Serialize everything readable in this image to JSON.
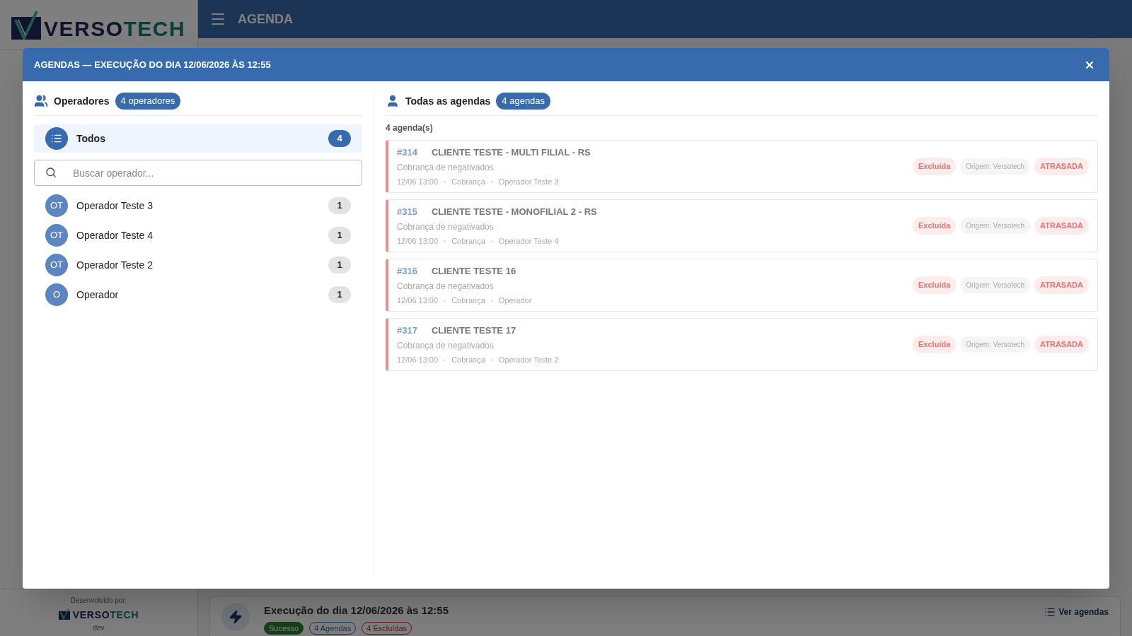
{
  "brand": {
    "part1": "VERSO",
    "part2": "TECH"
  },
  "topbar": {
    "title": "AGENDA"
  },
  "footer": {
    "caption": "Desenvolvido por:",
    "brand": {
      "part1": "VERSO",
      "part2": "TECH"
    },
    "env": "dev"
  },
  "execution": {
    "title": "Execução do dia 12/06/2026 às 12:55",
    "link": "Ver agendas",
    "badges": [
      {
        "label": "Sucesso",
        "kind": "success"
      },
      {
        "label": "4 Agendas",
        "kind": "info"
      },
      {
        "label": "4 Excluídas",
        "kind": "danger"
      }
    ]
  },
  "modal": {
    "title": "AGENDAS — EXECUÇÃO DO DIA 12/06/2026 ÀS 12:55",
    "operators": {
      "title": "Operadores",
      "count": "4 operadores",
      "all": {
        "label": "Todos",
        "count": "4",
        "selected": true
      },
      "search": {
        "placeholder": "Buscar operador..."
      },
      "items": [
        {
          "initials": "OT",
          "name": "Operador Teste 3",
          "count": "1",
          "selected": false
        },
        {
          "initials": "OT",
          "name": "Operador Teste 4",
          "count": "1",
          "selected": false
        },
        {
          "initials": "OT",
          "name": "Operador Teste 2",
          "count": "1",
          "selected": false
        },
        {
          "initials": "O",
          "name": "Operador",
          "count": "1",
          "selected": false
        }
      ]
    },
    "agendas": {
      "title": "Todas as agendas",
      "count": "4 agendas",
      "summary": "4 agenda(s)",
      "items": [
        {
          "id": "#314",
          "client": "CLIENTE TESTE - MULTI FILIAL - RS",
          "description": "Cobrança de negativados",
          "time": "12/06 13:00",
          "category": "Cobrança",
          "operator": "Operador Teste 3",
          "tags": [
            {
              "label": "Excluída",
              "kind": "status"
            },
            {
              "label": "Origem: Versotech",
              "kind": "origin"
            },
            {
              "label": "ATRASADA",
              "kind": "late"
            }
          ]
        },
        {
          "id": "#315",
          "client": "CLIENTE TESTE - MONOFILIAL 2 - RS",
          "description": "Cobrança de negativados",
          "time": "12/06 13:00",
          "category": "Cobrança",
          "operator": "Operador Teste 4",
          "tags": [
            {
              "label": "Excluída",
              "kind": "status"
            },
            {
              "label": "Origem: Versotech",
              "kind": "origin"
            },
            {
              "label": "ATRASADA",
              "kind": "late"
            }
          ]
        },
        {
          "id": "#316",
          "client": "CLIENTE TESTE 16",
          "description": "Cobrança de negativados",
          "time": "12/06 13:00",
          "category": "Cobrança",
          "operator": "Operador",
          "tags": [
            {
              "label": "Excluída",
              "kind": "status"
            },
            {
              "label": "Origem: Versotech",
              "kind": "origin"
            },
            {
              "label": "ATRASADA",
              "kind": "late"
            }
          ]
        },
        {
          "id": "#317",
          "client": "CLIENTE TESTE 17",
          "description": "Cobrança de negativados",
          "time": "12/06 13:00",
          "category": "Cobrança",
          "operator": "Operador Teste 2",
          "tags": [
            {
              "label": "Excluída",
              "kind": "status"
            },
            {
              "label": "Origem: Versotech",
              "kind": "origin"
            },
            {
              "label": "ATRASADA",
              "kind": "late"
            }
          ]
        }
      ]
    }
  }
}
